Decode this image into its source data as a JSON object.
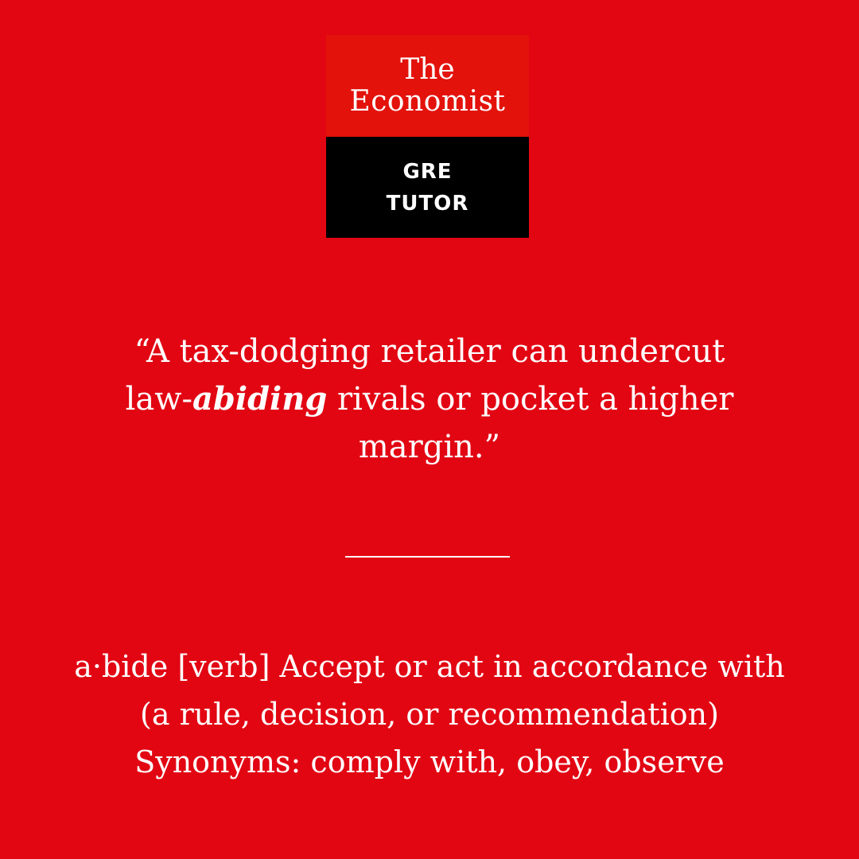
{
  "logo": {
    "line1": "The",
    "line2": "Economist",
    "sub1": "GRE",
    "sub2": "TUTOR"
  },
  "quote": {
    "part1": "“A tax-dodging retailer can undercut",
    "part2_prefix": "law-",
    "highlight": "abiding",
    "part2_suffix": " rivals or pocket a higher",
    "part3": "margin.”"
  },
  "definition": {
    "line1": "a·bide [verb] Accept or act in accordance with",
    "line2": "(a rule, decision, or recommendation)",
    "line3": "Synonyms: comply with, obey, observe"
  },
  "colors": {
    "background": "#e20613",
    "logo_red": "#e3120b",
    "logo_black": "#000000",
    "text": "#ffffff"
  }
}
